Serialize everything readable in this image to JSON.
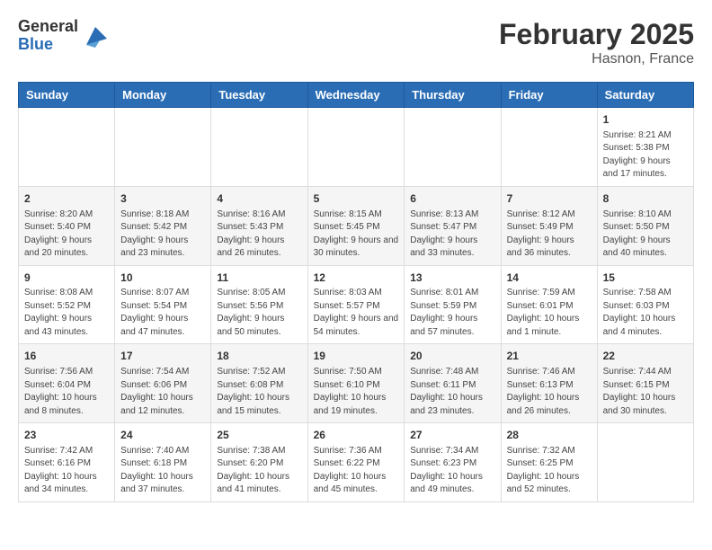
{
  "logo": {
    "general": "General",
    "blue": "Blue"
  },
  "title": "February 2025",
  "location": "Hasnon, France",
  "days_of_week": [
    "Sunday",
    "Monday",
    "Tuesday",
    "Wednesday",
    "Thursday",
    "Friday",
    "Saturday"
  ],
  "weeks": [
    [
      {
        "day": "",
        "info": ""
      },
      {
        "day": "",
        "info": ""
      },
      {
        "day": "",
        "info": ""
      },
      {
        "day": "",
        "info": ""
      },
      {
        "day": "",
        "info": ""
      },
      {
        "day": "",
        "info": ""
      },
      {
        "day": "1",
        "info": "Sunrise: 8:21 AM\nSunset: 5:38 PM\nDaylight: 9 hours and 17 minutes."
      }
    ],
    [
      {
        "day": "2",
        "info": "Sunrise: 8:20 AM\nSunset: 5:40 PM\nDaylight: 9 hours and 20 minutes."
      },
      {
        "day": "3",
        "info": "Sunrise: 8:18 AM\nSunset: 5:42 PM\nDaylight: 9 hours and 23 minutes."
      },
      {
        "day": "4",
        "info": "Sunrise: 8:16 AM\nSunset: 5:43 PM\nDaylight: 9 hours and 26 minutes."
      },
      {
        "day": "5",
        "info": "Sunrise: 8:15 AM\nSunset: 5:45 PM\nDaylight: 9 hours and 30 minutes."
      },
      {
        "day": "6",
        "info": "Sunrise: 8:13 AM\nSunset: 5:47 PM\nDaylight: 9 hours and 33 minutes."
      },
      {
        "day": "7",
        "info": "Sunrise: 8:12 AM\nSunset: 5:49 PM\nDaylight: 9 hours and 36 minutes."
      },
      {
        "day": "8",
        "info": "Sunrise: 8:10 AM\nSunset: 5:50 PM\nDaylight: 9 hours and 40 minutes."
      }
    ],
    [
      {
        "day": "9",
        "info": "Sunrise: 8:08 AM\nSunset: 5:52 PM\nDaylight: 9 hours and 43 minutes."
      },
      {
        "day": "10",
        "info": "Sunrise: 8:07 AM\nSunset: 5:54 PM\nDaylight: 9 hours and 47 minutes."
      },
      {
        "day": "11",
        "info": "Sunrise: 8:05 AM\nSunset: 5:56 PM\nDaylight: 9 hours and 50 minutes."
      },
      {
        "day": "12",
        "info": "Sunrise: 8:03 AM\nSunset: 5:57 PM\nDaylight: 9 hours and 54 minutes."
      },
      {
        "day": "13",
        "info": "Sunrise: 8:01 AM\nSunset: 5:59 PM\nDaylight: 9 hours and 57 minutes."
      },
      {
        "day": "14",
        "info": "Sunrise: 7:59 AM\nSunset: 6:01 PM\nDaylight: 10 hours and 1 minute."
      },
      {
        "day": "15",
        "info": "Sunrise: 7:58 AM\nSunset: 6:03 PM\nDaylight: 10 hours and 4 minutes."
      }
    ],
    [
      {
        "day": "16",
        "info": "Sunrise: 7:56 AM\nSunset: 6:04 PM\nDaylight: 10 hours and 8 minutes."
      },
      {
        "day": "17",
        "info": "Sunrise: 7:54 AM\nSunset: 6:06 PM\nDaylight: 10 hours and 12 minutes."
      },
      {
        "day": "18",
        "info": "Sunrise: 7:52 AM\nSunset: 6:08 PM\nDaylight: 10 hours and 15 minutes."
      },
      {
        "day": "19",
        "info": "Sunrise: 7:50 AM\nSunset: 6:10 PM\nDaylight: 10 hours and 19 minutes."
      },
      {
        "day": "20",
        "info": "Sunrise: 7:48 AM\nSunset: 6:11 PM\nDaylight: 10 hours and 23 minutes."
      },
      {
        "day": "21",
        "info": "Sunrise: 7:46 AM\nSunset: 6:13 PM\nDaylight: 10 hours and 26 minutes."
      },
      {
        "day": "22",
        "info": "Sunrise: 7:44 AM\nSunset: 6:15 PM\nDaylight: 10 hours and 30 minutes."
      }
    ],
    [
      {
        "day": "23",
        "info": "Sunrise: 7:42 AM\nSunset: 6:16 PM\nDaylight: 10 hours and 34 minutes."
      },
      {
        "day": "24",
        "info": "Sunrise: 7:40 AM\nSunset: 6:18 PM\nDaylight: 10 hours and 37 minutes."
      },
      {
        "day": "25",
        "info": "Sunrise: 7:38 AM\nSunset: 6:20 PM\nDaylight: 10 hours and 41 minutes."
      },
      {
        "day": "26",
        "info": "Sunrise: 7:36 AM\nSunset: 6:22 PM\nDaylight: 10 hours and 45 minutes."
      },
      {
        "day": "27",
        "info": "Sunrise: 7:34 AM\nSunset: 6:23 PM\nDaylight: 10 hours and 49 minutes."
      },
      {
        "day": "28",
        "info": "Sunrise: 7:32 AM\nSunset: 6:25 PM\nDaylight: 10 hours and 52 minutes."
      },
      {
        "day": "",
        "info": ""
      }
    ]
  ]
}
